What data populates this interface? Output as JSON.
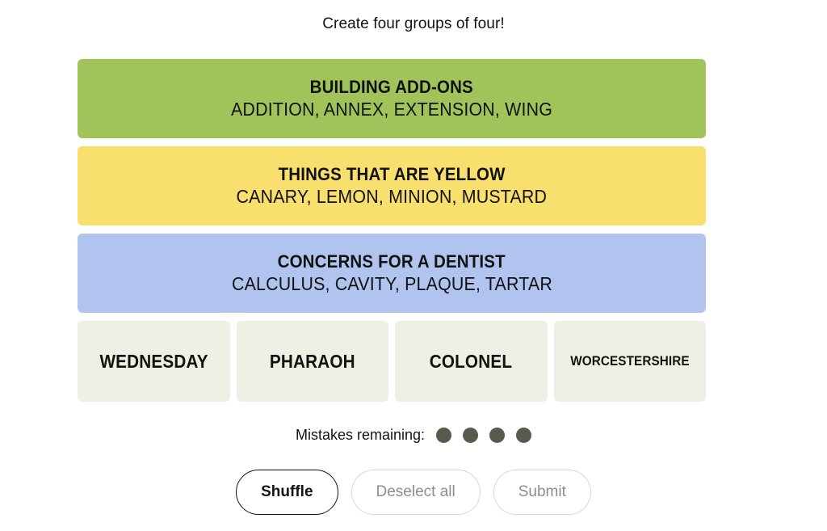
{
  "instruction": "Create four groups of four!",
  "solved_groups": [
    {
      "color_name": "green",
      "color": "#A0C35A",
      "title": "BUILDING ADD-ONS",
      "members": "ADDITION, ANNEX, EXTENSION, WING"
    },
    {
      "color_name": "yellow",
      "color": "#F9DF6D",
      "title": "THINGS THAT ARE YELLOW",
      "members": "CANARY, LEMON, MINION, MUSTARD"
    },
    {
      "color_name": "blue",
      "color": "#B0C4EF",
      "title": "CONCERNS FOR A DENTIST",
      "members": "CALCULUS, CAVITY, PLAQUE, TARTAR"
    }
  ],
  "tiles": [
    {
      "label": "WEDNESDAY",
      "size": "normal"
    },
    {
      "label": "PHARAOH",
      "size": "normal"
    },
    {
      "label": "COLONEL",
      "size": "normal"
    },
    {
      "label": "WORCESTERSHIRE",
      "size": "small"
    }
  ],
  "tile_color": "#EFEFE6",
  "mistakes": {
    "label": "Mistakes remaining:",
    "remaining": 4,
    "dot_color": "#5A594E"
  },
  "buttons": [
    {
      "label": "Shuffle",
      "state": "active"
    },
    {
      "label": "Deselect all",
      "state": "disabled"
    },
    {
      "label": "Submit",
      "state": "disabled"
    }
  ]
}
